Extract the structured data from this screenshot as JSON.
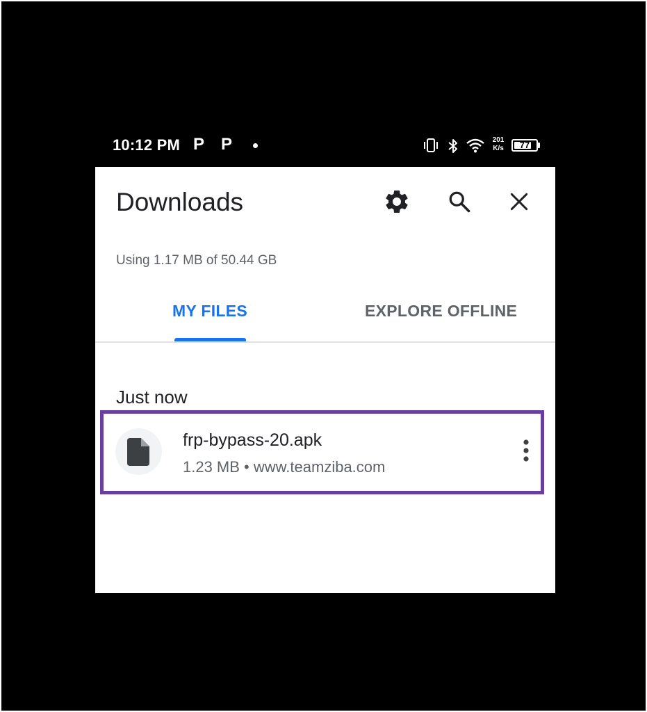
{
  "status_bar": {
    "time": "10:12 PM",
    "notif_icons": [
      "P",
      "P"
    ],
    "net_speed_value": "201",
    "net_speed_unit": "K/s",
    "battery_level": "77",
    "icons": [
      "vibrate-icon",
      "bluetooth-icon",
      "wifi-icon",
      "battery-icon"
    ]
  },
  "header": {
    "title": "Downloads",
    "icons": [
      "gear-icon",
      "search-icon",
      "close-icon"
    ]
  },
  "storage": {
    "usage_text": "Using 1.17 MB of 50.44 GB"
  },
  "tabs": [
    {
      "label": "MY FILES",
      "selected": true
    },
    {
      "label": "EXPLORE OFFLINE",
      "selected": false
    }
  ],
  "sections": [
    {
      "heading": "Just now",
      "items": [
        {
          "name": "frp-bypass-20.apk",
          "meta": "1.23 MB • www.teamziba.com",
          "icon": "file-icon"
        }
      ]
    }
  ],
  "colors": {
    "accent": "#1a73e8",
    "highlight_border": "#6a3ea1",
    "background": "#000000",
    "panel": "#ffffff"
  }
}
